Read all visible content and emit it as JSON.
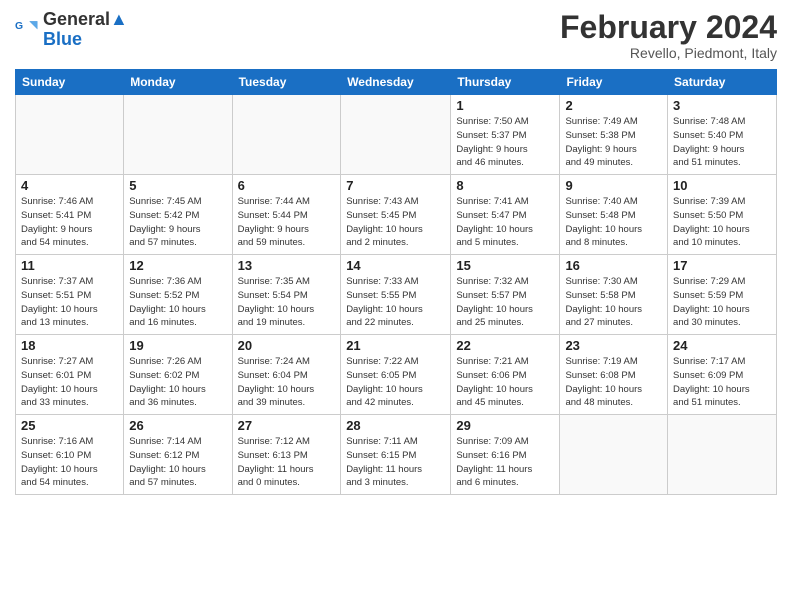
{
  "logo": {
    "line1": "General",
    "line2": "Blue"
  },
  "title": "February 2024",
  "subtitle": "Revello, Piedmont, Italy",
  "days_header": [
    "Sunday",
    "Monday",
    "Tuesday",
    "Wednesday",
    "Thursday",
    "Friday",
    "Saturday"
  ],
  "weeks": [
    [
      {
        "day": "",
        "info": ""
      },
      {
        "day": "",
        "info": ""
      },
      {
        "day": "",
        "info": ""
      },
      {
        "day": "",
        "info": ""
      },
      {
        "day": "1",
        "info": "Sunrise: 7:50 AM\nSunset: 5:37 PM\nDaylight: 9 hours\nand 46 minutes."
      },
      {
        "day": "2",
        "info": "Sunrise: 7:49 AM\nSunset: 5:38 PM\nDaylight: 9 hours\nand 49 minutes."
      },
      {
        "day": "3",
        "info": "Sunrise: 7:48 AM\nSunset: 5:40 PM\nDaylight: 9 hours\nand 51 minutes."
      }
    ],
    [
      {
        "day": "4",
        "info": "Sunrise: 7:46 AM\nSunset: 5:41 PM\nDaylight: 9 hours\nand 54 minutes."
      },
      {
        "day": "5",
        "info": "Sunrise: 7:45 AM\nSunset: 5:42 PM\nDaylight: 9 hours\nand 57 minutes."
      },
      {
        "day": "6",
        "info": "Sunrise: 7:44 AM\nSunset: 5:44 PM\nDaylight: 9 hours\nand 59 minutes."
      },
      {
        "day": "7",
        "info": "Sunrise: 7:43 AM\nSunset: 5:45 PM\nDaylight: 10 hours\nand 2 minutes."
      },
      {
        "day": "8",
        "info": "Sunrise: 7:41 AM\nSunset: 5:47 PM\nDaylight: 10 hours\nand 5 minutes."
      },
      {
        "day": "9",
        "info": "Sunrise: 7:40 AM\nSunset: 5:48 PM\nDaylight: 10 hours\nand 8 minutes."
      },
      {
        "day": "10",
        "info": "Sunrise: 7:39 AM\nSunset: 5:50 PM\nDaylight: 10 hours\nand 10 minutes."
      }
    ],
    [
      {
        "day": "11",
        "info": "Sunrise: 7:37 AM\nSunset: 5:51 PM\nDaylight: 10 hours\nand 13 minutes."
      },
      {
        "day": "12",
        "info": "Sunrise: 7:36 AM\nSunset: 5:52 PM\nDaylight: 10 hours\nand 16 minutes."
      },
      {
        "day": "13",
        "info": "Sunrise: 7:35 AM\nSunset: 5:54 PM\nDaylight: 10 hours\nand 19 minutes."
      },
      {
        "day": "14",
        "info": "Sunrise: 7:33 AM\nSunset: 5:55 PM\nDaylight: 10 hours\nand 22 minutes."
      },
      {
        "day": "15",
        "info": "Sunrise: 7:32 AM\nSunset: 5:57 PM\nDaylight: 10 hours\nand 25 minutes."
      },
      {
        "day": "16",
        "info": "Sunrise: 7:30 AM\nSunset: 5:58 PM\nDaylight: 10 hours\nand 27 minutes."
      },
      {
        "day": "17",
        "info": "Sunrise: 7:29 AM\nSunset: 5:59 PM\nDaylight: 10 hours\nand 30 minutes."
      }
    ],
    [
      {
        "day": "18",
        "info": "Sunrise: 7:27 AM\nSunset: 6:01 PM\nDaylight: 10 hours\nand 33 minutes."
      },
      {
        "day": "19",
        "info": "Sunrise: 7:26 AM\nSunset: 6:02 PM\nDaylight: 10 hours\nand 36 minutes."
      },
      {
        "day": "20",
        "info": "Sunrise: 7:24 AM\nSunset: 6:04 PM\nDaylight: 10 hours\nand 39 minutes."
      },
      {
        "day": "21",
        "info": "Sunrise: 7:22 AM\nSunset: 6:05 PM\nDaylight: 10 hours\nand 42 minutes."
      },
      {
        "day": "22",
        "info": "Sunrise: 7:21 AM\nSunset: 6:06 PM\nDaylight: 10 hours\nand 45 minutes."
      },
      {
        "day": "23",
        "info": "Sunrise: 7:19 AM\nSunset: 6:08 PM\nDaylight: 10 hours\nand 48 minutes."
      },
      {
        "day": "24",
        "info": "Sunrise: 7:17 AM\nSunset: 6:09 PM\nDaylight: 10 hours\nand 51 minutes."
      }
    ],
    [
      {
        "day": "25",
        "info": "Sunrise: 7:16 AM\nSunset: 6:10 PM\nDaylight: 10 hours\nand 54 minutes."
      },
      {
        "day": "26",
        "info": "Sunrise: 7:14 AM\nSunset: 6:12 PM\nDaylight: 10 hours\nand 57 minutes."
      },
      {
        "day": "27",
        "info": "Sunrise: 7:12 AM\nSunset: 6:13 PM\nDaylight: 11 hours\nand 0 minutes."
      },
      {
        "day": "28",
        "info": "Sunrise: 7:11 AM\nSunset: 6:15 PM\nDaylight: 11 hours\nand 3 minutes."
      },
      {
        "day": "29",
        "info": "Sunrise: 7:09 AM\nSunset: 6:16 PM\nDaylight: 11 hours\nand 6 minutes."
      },
      {
        "day": "",
        "info": ""
      },
      {
        "day": "",
        "info": ""
      }
    ]
  ]
}
